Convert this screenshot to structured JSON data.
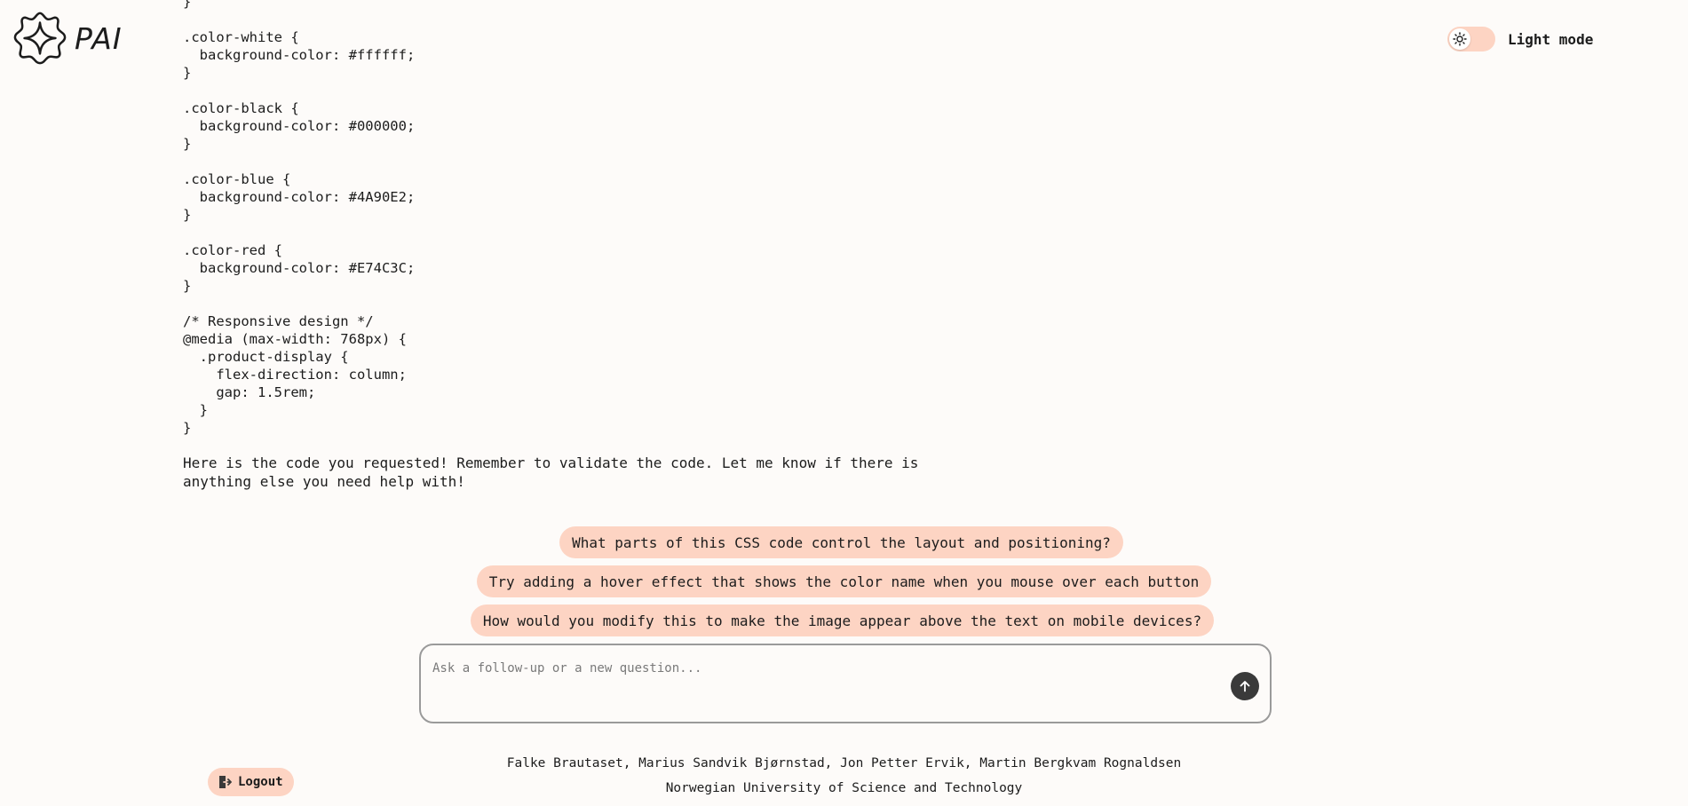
{
  "app": {
    "logo_text": "PAI"
  },
  "theme_toggle": {
    "label": "Light mode"
  },
  "chat": {
    "code_lines": [
      "}",
      "",
      ".color-white {",
      "  background-color: #ffffff;",
      "}",
      "",
      ".color-black {",
      "  background-color: #000000;",
      "}",
      "",
      ".color-blue {",
      "  background-color: #4A90E2;",
      "}",
      "",
      ".color-red {",
      "  background-color: #E74C3C;",
      "}",
      "",
      "/* Responsive design */",
      "@media (max-width: 768px) {",
      "  .product-display {",
      "    flex-direction: column;",
      "    gap: 1.5rem;",
      "  }",
      "}"
    ],
    "reply_text": "Here is the code you requested! Remember to validate the code. Let me know if there is anything else you need help with!"
  },
  "suggestions": [
    "What parts of this CSS code control the layout and positioning?",
    "Try adding a hover effect that shows the color name when you mouse over each button",
    "How would you modify this to make the image appear above the text on mobile devices?"
  ],
  "ask": {
    "placeholder": "Ask a follow-up or a new question...",
    "value": ""
  },
  "footer": {
    "logout_label": "Logout",
    "authors": "Falke Brautaset, Marius Sandvik Bjørnstad, Jon Petter Ervik, Martin Bergkvam Rognaldsen",
    "institution": "Norwegian University of Science and Technology"
  },
  "colors": {
    "accent": "#fdd4c3",
    "background": "#fdfbf9",
    "text": "#1c1c1c",
    "send_button": "#3a3a3a"
  },
  "icons": {
    "logo": "sparkle-logo-icon",
    "theme": "sun-icon",
    "send": "arrow-up-icon",
    "logout": "logout-icon"
  }
}
